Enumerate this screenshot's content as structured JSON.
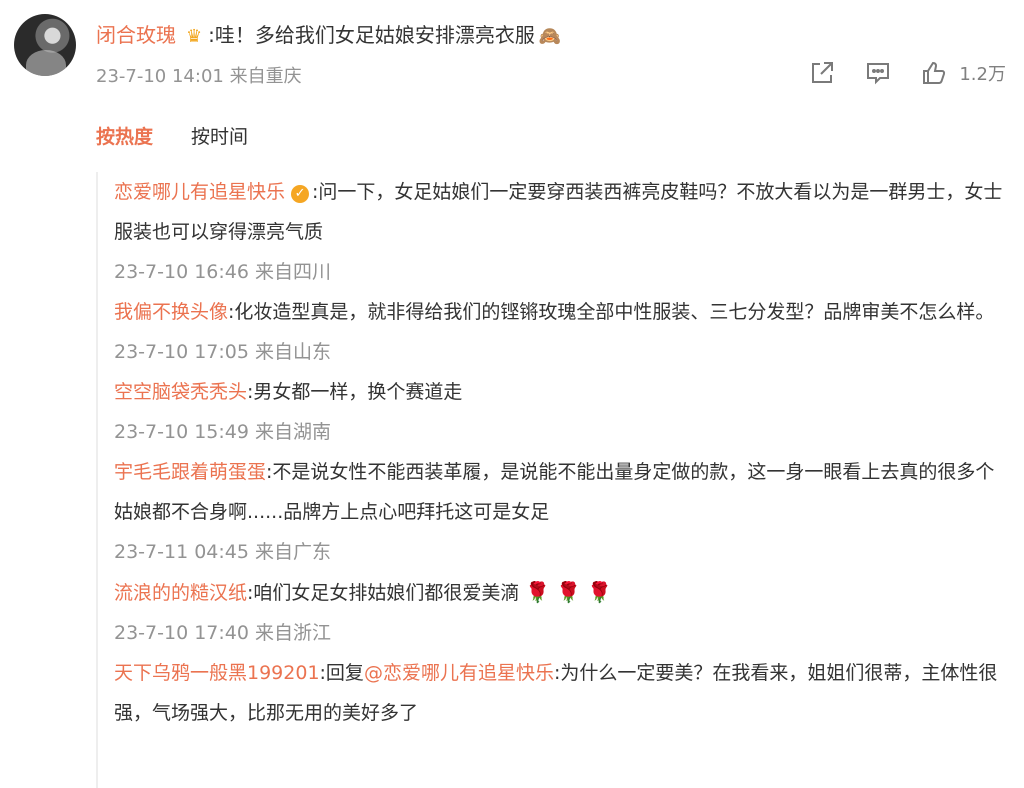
{
  "comment": {
    "username": "闭合玫瑰",
    "crown_icon": "crown-icon",
    "text": ":哇！多给我们女足姑娘安排漂亮衣服",
    "emoji": "🙈",
    "time": "23-7-10 14:01",
    "location": "来自重庆",
    "likes": "1.2万"
  },
  "tabs": {
    "hot": "按热度",
    "time": "按时间"
  },
  "replies": [
    {
      "username": "恋爱哪儿有追星快乐",
      "verified": true,
      "text": ":问一下，女足姑娘们一定要穿西装西裤亮皮鞋吗？不放大看以为是一群男士，女士服装也可以穿得漂亮气质",
      "time": "23-7-10 16:46",
      "location": "来自四川"
    },
    {
      "username": "我偏不换头像",
      "text": ":化妆造型真是，就非得给我们的铿锵玫瑰全部中性服装、三七分发型？品牌审美不怎么样。",
      "time": "23-7-10 17:05",
      "location": "来自山东"
    },
    {
      "username": "空空脑袋秃秃头",
      "text": ":男女都一样，换个赛道走",
      "time": "23-7-10 15:49",
      "location": "来自湖南"
    },
    {
      "username": "宇毛毛跟着萌蛋蛋",
      "text": ":不是说女性不能西装革履，是说能不能出量身定做的款，这一身一眼看上去真的很多个姑娘都不合身啊......品牌方上点心吧拜托这可是女足",
      "time": "23-7-11 04:45",
      "location": "来自广东"
    },
    {
      "username": "流浪的的糙汉纸",
      "text": ":咱们女足女排姑娘们都很爱美滴",
      "roses": [
        "🌹",
        "🌹",
        "🌹"
      ],
      "time": "23-7-10 17:40",
      "location": "来自浙江"
    },
    {
      "username": "天下乌鸦一般黑199201",
      "reply_prefix": ":回复",
      "mention": "@恋爱哪儿有追星快乐",
      "text": ":为什么一定要美？在我看来，姐姐们很蒂，主体性很强，气场强大，比那无用的美好多了"
    }
  ]
}
